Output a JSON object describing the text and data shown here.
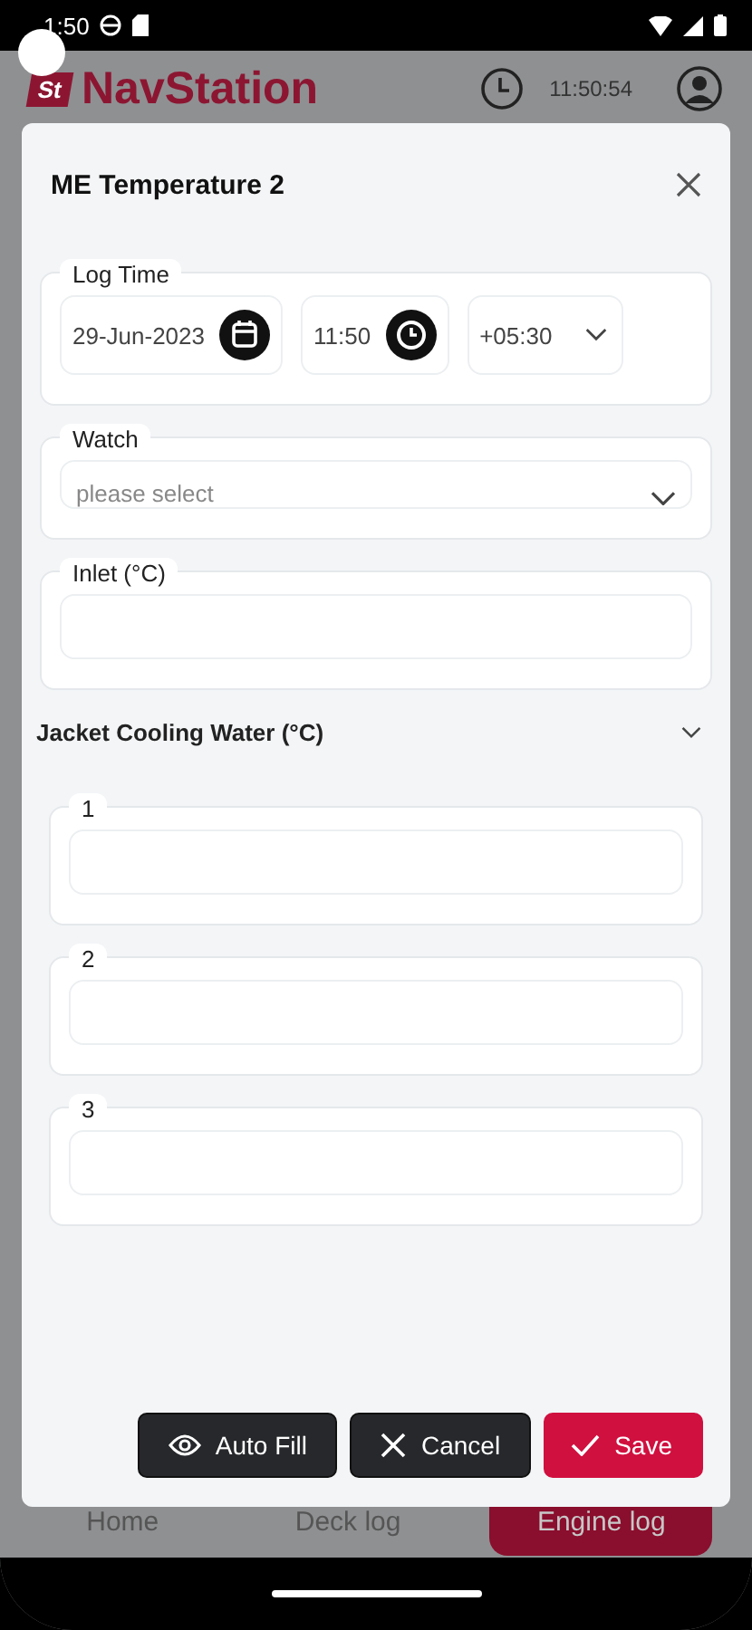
{
  "status_bar": {
    "time": "1:50"
  },
  "header": {
    "logo_badge": "St",
    "logo_text": "NavStation",
    "clock": "11:50:54"
  },
  "dialog": {
    "title": "ME Temperature 2",
    "log_time": {
      "label": "Log Time",
      "date": "29-Jun-2023",
      "time": "11:50",
      "offset": "+05:30"
    },
    "watch": {
      "label": "Watch",
      "placeholder": "please select"
    },
    "inlet": {
      "label": "Inlet (°C)"
    },
    "group": {
      "title": "Jacket Cooling Water (°C)",
      "expanded": true,
      "fields": [
        {
          "label": "1"
        },
        {
          "label": "2"
        },
        {
          "label": "3"
        }
      ]
    },
    "buttons": [
      {
        "label": "Auto Fill",
        "kind": "autofill"
      },
      {
        "label": "Cancel",
        "kind": "cancel"
      },
      {
        "label": "Save",
        "kind": "save"
      }
    ]
  },
  "bottom_nav": [
    {
      "label": "Home",
      "selected": false
    },
    {
      "label": "Deck log",
      "selected": false
    },
    {
      "label": "Engine log",
      "selected": true
    }
  ]
}
